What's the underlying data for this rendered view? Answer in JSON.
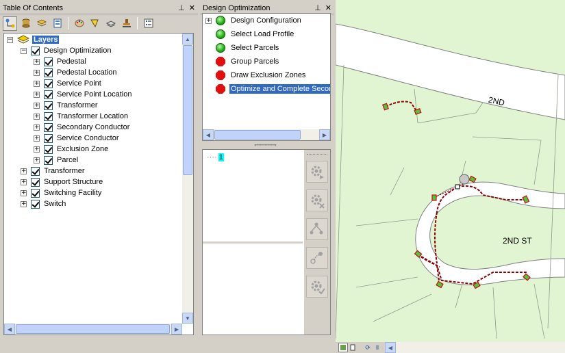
{
  "toc": {
    "title": "Table Of Contents",
    "pin_glyph": "⊥",
    "close_glyph": "✕",
    "root": {
      "label": "Layers"
    },
    "group": {
      "label": "Design Optimization"
    },
    "group_items": [
      {
        "label": "Pedestal"
      },
      {
        "label": "Pedestal Location"
      },
      {
        "label": "Service Point"
      },
      {
        "label": "Service Point Location"
      },
      {
        "label": "Transformer"
      },
      {
        "label": "Transformer Location"
      },
      {
        "label": "Secondary Conductor"
      },
      {
        "label": "Service Conductor"
      },
      {
        "label": "Exclusion Zone"
      },
      {
        "label": "Parcel"
      }
    ],
    "top_items": [
      {
        "label": "Transformer"
      },
      {
        "label": "Support Structure"
      },
      {
        "label": "Switching Facility"
      },
      {
        "label": "Switch"
      }
    ]
  },
  "design_optimization": {
    "title": "Design Optimization",
    "steps": [
      {
        "label": "Design Configuration",
        "status": "complete",
        "expandable": true
      },
      {
        "label": "Select Load Profile",
        "status": "complete"
      },
      {
        "label": "Select Parcels",
        "status": "complete"
      },
      {
        "label": "Group Parcels",
        "status": "pending"
      },
      {
        "label": "Draw Exclusion Zones",
        "status": "pending"
      },
      {
        "label": "Optimize and Complete Secondary",
        "status": "pending",
        "selected": true
      }
    ],
    "tree_node": "1"
  },
  "map": {
    "labels": {
      "street_top": "2ND",
      "street_cul": "2ND ST"
    }
  },
  "colors": {
    "selection": "#316ac5",
    "map_bg": "#e2f5d3",
    "conductor": "#8b0000",
    "complete": "#1fae12",
    "pending": "#e01010"
  }
}
